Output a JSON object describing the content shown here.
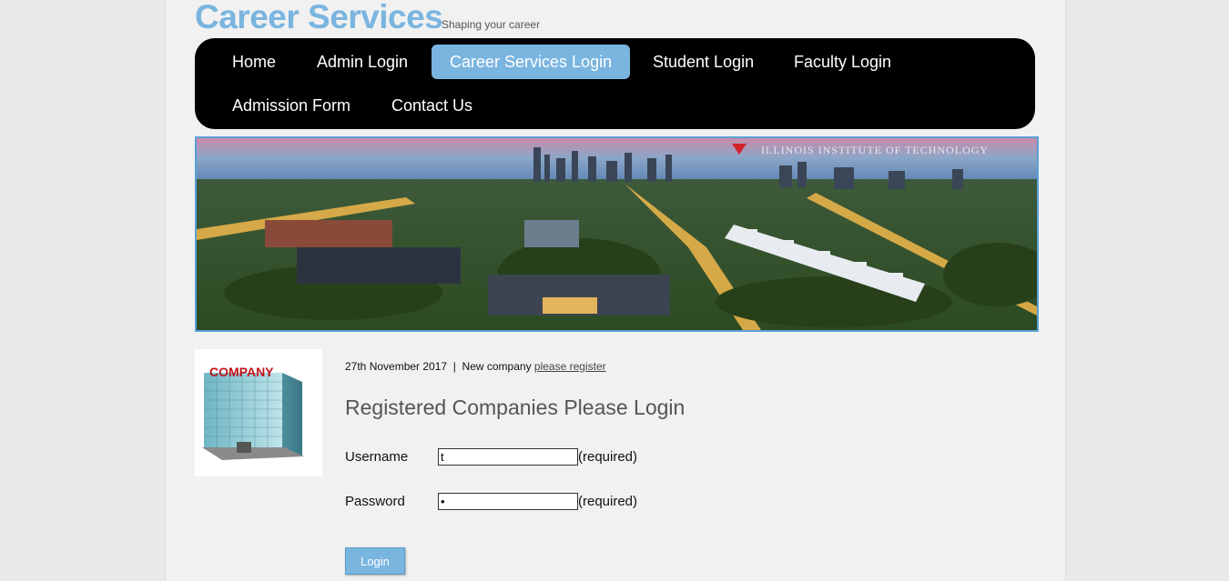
{
  "header": {
    "title": "Career Services",
    "tagline": "Shaping your career"
  },
  "nav": {
    "items": [
      {
        "label": "Home"
      },
      {
        "label": "Admin Login"
      },
      {
        "label": "Career Services Login",
        "active": true
      },
      {
        "label": "Student Login"
      },
      {
        "label": "Faculty Login"
      },
      {
        "label": "Admission Form"
      },
      {
        "label": "Contact Us"
      }
    ],
    "active_color": "#7ab5e0",
    "background_color": "#000000"
  },
  "banner": {
    "institution": "ILLINOIS INSTITUTE OF TECHNOLOGY"
  },
  "company_image": {
    "sign_text": "COMPANY"
  },
  "info": {
    "date": "27th November 2017",
    "separator": "|",
    "new_company_text": "New company",
    "register_link": "please register"
  },
  "form": {
    "heading": "Registered Companies Please Login",
    "username_label": "Username",
    "username_value": "t",
    "password_label": "Password",
    "password_value": "a",
    "required_text": "(required)",
    "login_button": "Login"
  },
  "colors": {
    "accent": "#7ab5e0",
    "page_background": "#f1f1f1"
  }
}
